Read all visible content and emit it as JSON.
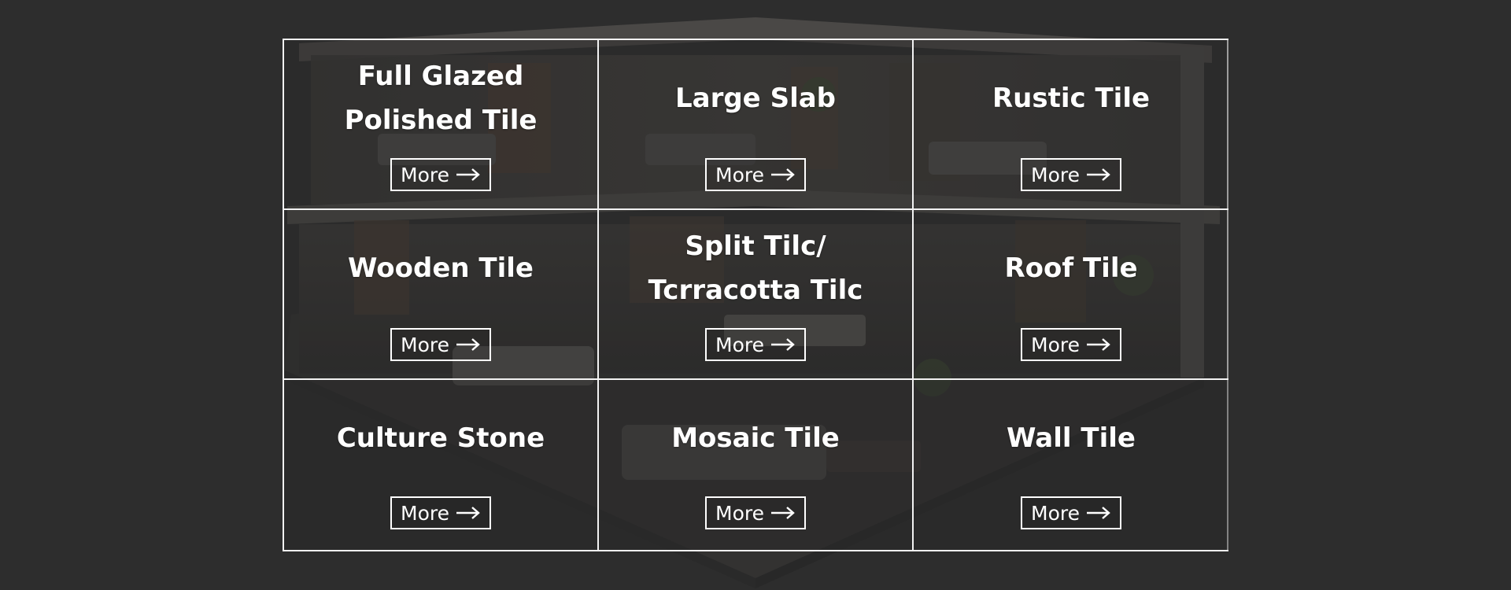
{
  "tiles": [
    {
      "title": "Full Glazed Polished Tile",
      "more_label": "More"
    },
    {
      "title": "Large Slab",
      "more_label": "More"
    },
    {
      "title": "Rustic Tile",
      "more_label": "More"
    },
    {
      "title": "Wooden Tile",
      "more_label": "More"
    },
    {
      "title": "Split Tilc/ Tcrracotta Tilc",
      "more_label": "More"
    },
    {
      "title": "Roof Tile",
      "more_label": "More"
    },
    {
      "title": "Culture Stone",
      "more_label": "More"
    },
    {
      "title": "Mosaic Tile",
      "more_label": "More"
    },
    {
      "title": "Wall Tile",
      "more_label": "More"
    }
  ],
  "icons": {
    "more_arrow": "arrow-right-icon",
    "background": "house-cutaway-image"
  },
  "colors": {
    "page_background": "#2d2d2d",
    "grid_lines": "#f2f2f2",
    "text": "#ffffff"
  }
}
